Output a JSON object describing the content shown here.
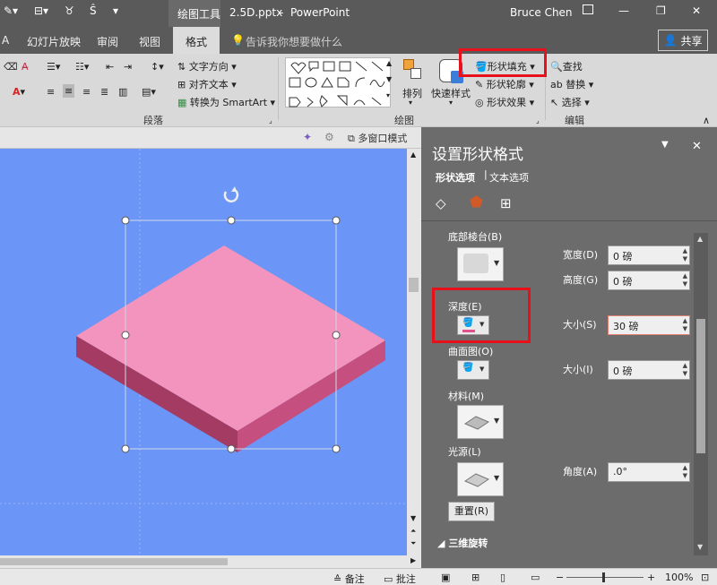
{
  "titlebar": {
    "context_tab": "绘图工具",
    "filename": "2.5D.pptx",
    "separator": "-",
    "app": "PowerPoint",
    "user": "Bruce Chen"
  },
  "tabs": {
    "items": [
      "A",
      "幻灯片放映",
      "审阅",
      "视图",
      "格式"
    ],
    "active": "格式",
    "tell_me": "告诉我你想要做什么",
    "share": "共享"
  },
  "ribbon": {
    "para_group": "段落",
    "draw_group": "绘图",
    "edit_group": "编辑",
    "text_direction": "文字方向",
    "align_text": "对齐文本",
    "convert_smartart": "转换为 SmartArt",
    "arrange": "排列",
    "quick_styles": "快速样式",
    "shape_fill": "形状填充",
    "shape_outline": "形状轮廓",
    "shape_effects": "形状效果",
    "find": "查找",
    "replace": "替换",
    "select": "选择"
  },
  "slide_toolbar": {
    "multi_window": "多窗口模式"
  },
  "pane": {
    "title": "设置形状格式",
    "tab_shape": "形状选项",
    "tab_text": "文本选项",
    "bottom_bevel": "底部棱台(B)",
    "width_label": "宽度(D)",
    "width_value": "0 磅",
    "height_label": "高度(G)",
    "height_value": "0 磅",
    "depth_label": "深度(E)",
    "depth_size_label": "大小(S)",
    "depth_size_value": "30 磅",
    "contour_label": "曲面图(O)",
    "contour_size_label": "大小(I)",
    "contour_size_value": "0 磅",
    "material_label": "材料(M)",
    "lighting_label": "光源(L)",
    "angle_label": "角度(A)",
    "angle_value": ".0°",
    "reset": "重置(R)",
    "rotation_section": "三维旋转"
  },
  "status": {
    "notes": "备注",
    "comments": "批注",
    "zoom": "100%"
  },
  "colors": {
    "slide_bg": "#6b96f7",
    "shape_top": "#f294bd",
    "shape_left": "#a33b63",
    "shape_right": "#c5507f",
    "highlight": "#e8101a"
  }
}
